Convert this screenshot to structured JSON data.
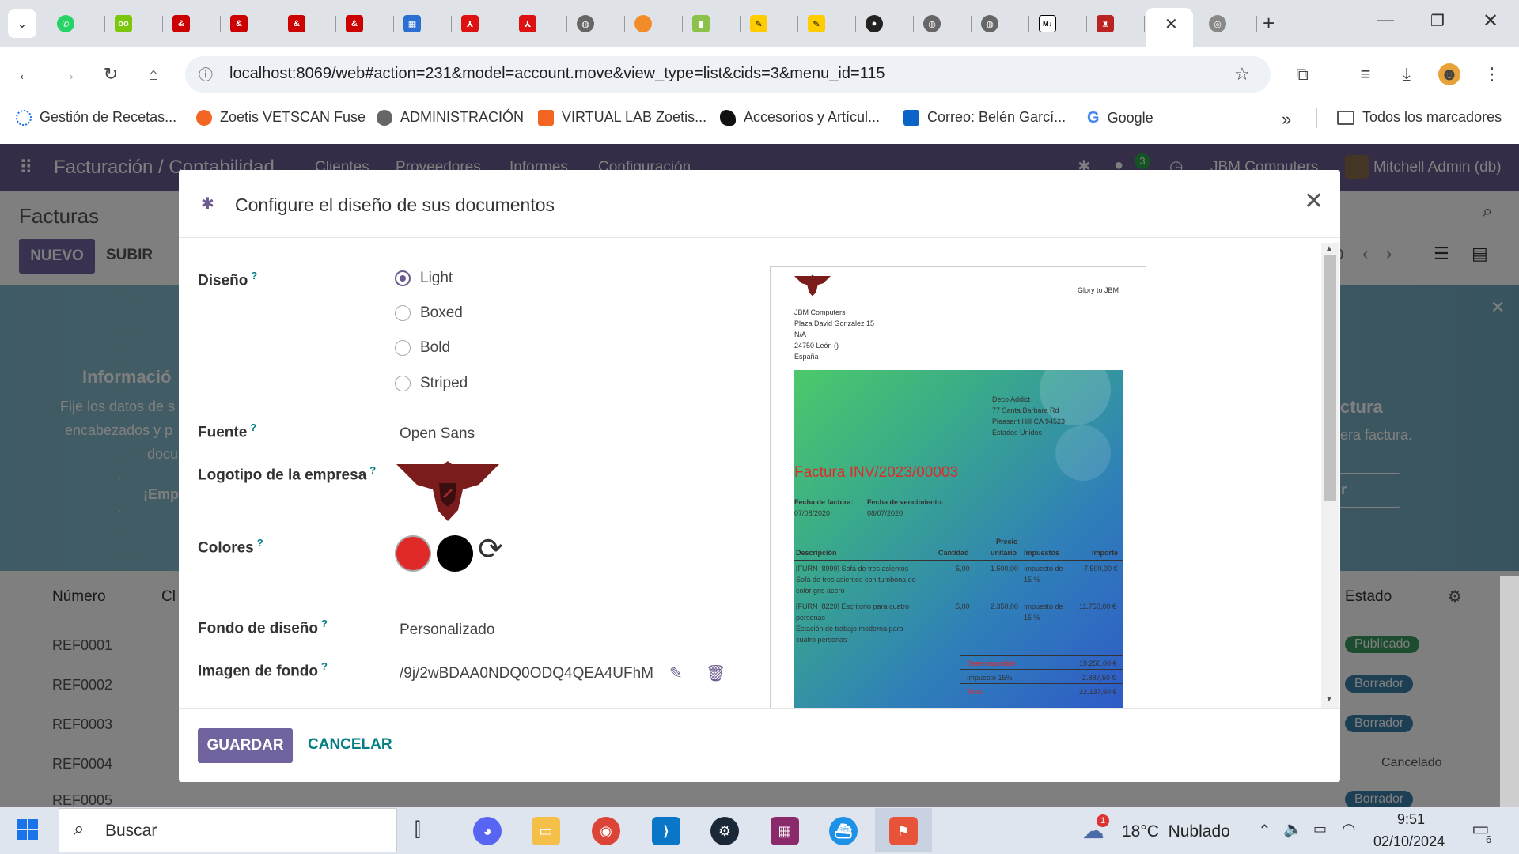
{
  "browser": {
    "url": "localhost:8069/web#action=231&model=account.move&view_type=list&cids=3&menu_id=115",
    "bookmarks": [
      "Gestión de Recetas...",
      "Zoetis VETSCAN Fuse",
      "ADMINISTRACIÓN",
      "VIRTUAL LAB Zoetis...",
      "Accesorios y Artícul...",
      "Correo: Belén Garcí...",
      "Google"
    ],
    "all_bookmarks": "Todos los marcadores",
    "more": "»"
  },
  "odoo": {
    "app": "Facturación / Contabilidad",
    "menu": [
      "Clientes",
      "Proveedores",
      "Informes",
      "Configuración"
    ],
    "badge": "3",
    "company": "JBM Computers",
    "user": "Mitchell Admin (db)",
    "page_title": "Facturas",
    "new_button": "NUEVO",
    "upload_button": "SUBIR",
    "banner_left_title": "Informació",
    "banner_left_text1": "Fije los datos de s",
    "banner_left_text2": "encabezados y p",
    "banner_left_text3": "docu",
    "banner_left_btn": "¡Emp",
    "banner_right_title": "ctura",
    "banner_right_text": "era factura.",
    "banner_right_btn": "r",
    "table_header_number": "Número",
    "table_header_client": "Cl",
    "table_header_state": "Estado",
    "rows": [
      {
        "ref": "REF0001",
        "state": "Publicado"
      },
      {
        "ref": "REF0002",
        "state": "Borrador"
      },
      {
        "ref": "REF0003",
        "state": "Borrador"
      },
      {
        "ref": "REF0004",
        "state": "Cancelado"
      },
      {
        "ref": "REF0005",
        "state": "Borrador"
      }
    ],
    "pager_num": "0"
  },
  "modal": {
    "title": "Configure el diseño de sus documentos",
    "labels": {
      "layout": "Diseño",
      "font": "Fuente",
      "logo": "Logotipo de la empresa",
      "colors": "Colores",
      "background": "Fondo de diseño",
      "bg_image": "Imagen de fondo"
    },
    "help": "?",
    "layouts": [
      "Light",
      "Boxed",
      "Bold",
      "Striped"
    ],
    "selected_layout": "Light",
    "font": "Open Sans",
    "colors": {
      "primary": "#e02a2a",
      "secondary": "#000000"
    },
    "background": "Personalizado",
    "bg_image": "/9j/2wBDAA0NDQ0ODQ4QEA4UFhM",
    "save": "GUARDAR",
    "cancel": "CANCELAR"
  },
  "preview": {
    "tagline": "Glory to JBM",
    "company_lines": [
      "JBM Computers",
      "Plaza David Gonzalez 15",
      "N/A",
      "24750 León ()",
      "España"
    ],
    "customer_lines": [
      "Deco Addict",
      "77 Santa Barbara Rd",
      "Pleasant Hill CA 94523",
      "Estados Unidos"
    ],
    "invoice_title": "Factura INV/2023/00003",
    "date_label": "Fecha de factura:",
    "date_value": "07/08/2020",
    "due_label": "Fecha de vencimiento:",
    "due_value": "08/07/2020",
    "col_desc": "Descripción",
    "col_qty": "Cantidad",
    "col_price_1": "Precio",
    "col_price_2": "unitario",
    "col_tax": "Impuestos",
    "col_amount": "Importe",
    "line1_a": "[FURN_8999] Sofá de tres asientos",
    "line1_b": "Sofá de tres asientos con tumbona de",
    "line1_c": "color gris acero",
    "line1_qty": "5,00",
    "line1_price": "1.500,00",
    "line1_tax_a": "Impuesto de",
    "line1_tax_b": "15 %",
    "line1_amount": "7.500,00 €",
    "line2_a": "[FURN_8220] Escritorio para cuatro",
    "line2_b": "personas",
    "line2_c": "Estación de trabajo moderna para",
    "line2_d": "cuatro personas",
    "line2_qty": "5,00",
    "line2_price": "2.350,00",
    "line2_tax_a": "Impuesto de",
    "line2_tax_b": "15 %",
    "line2_amount": "11.750,00 €",
    "base_label": "Base imponible",
    "base_value": "19.250,00 €",
    "tax_label": "Impuesto 15%",
    "tax_value": "2.887,50 €",
    "total_label": "Total",
    "total_value": "22.137,50 €"
  },
  "taskbar": {
    "search": "Buscar",
    "weather_badge": "1",
    "weather": "18°C  Nublado",
    "time": "9:51",
    "date": "02/10/2024",
    "notif": "6"
  }
}
